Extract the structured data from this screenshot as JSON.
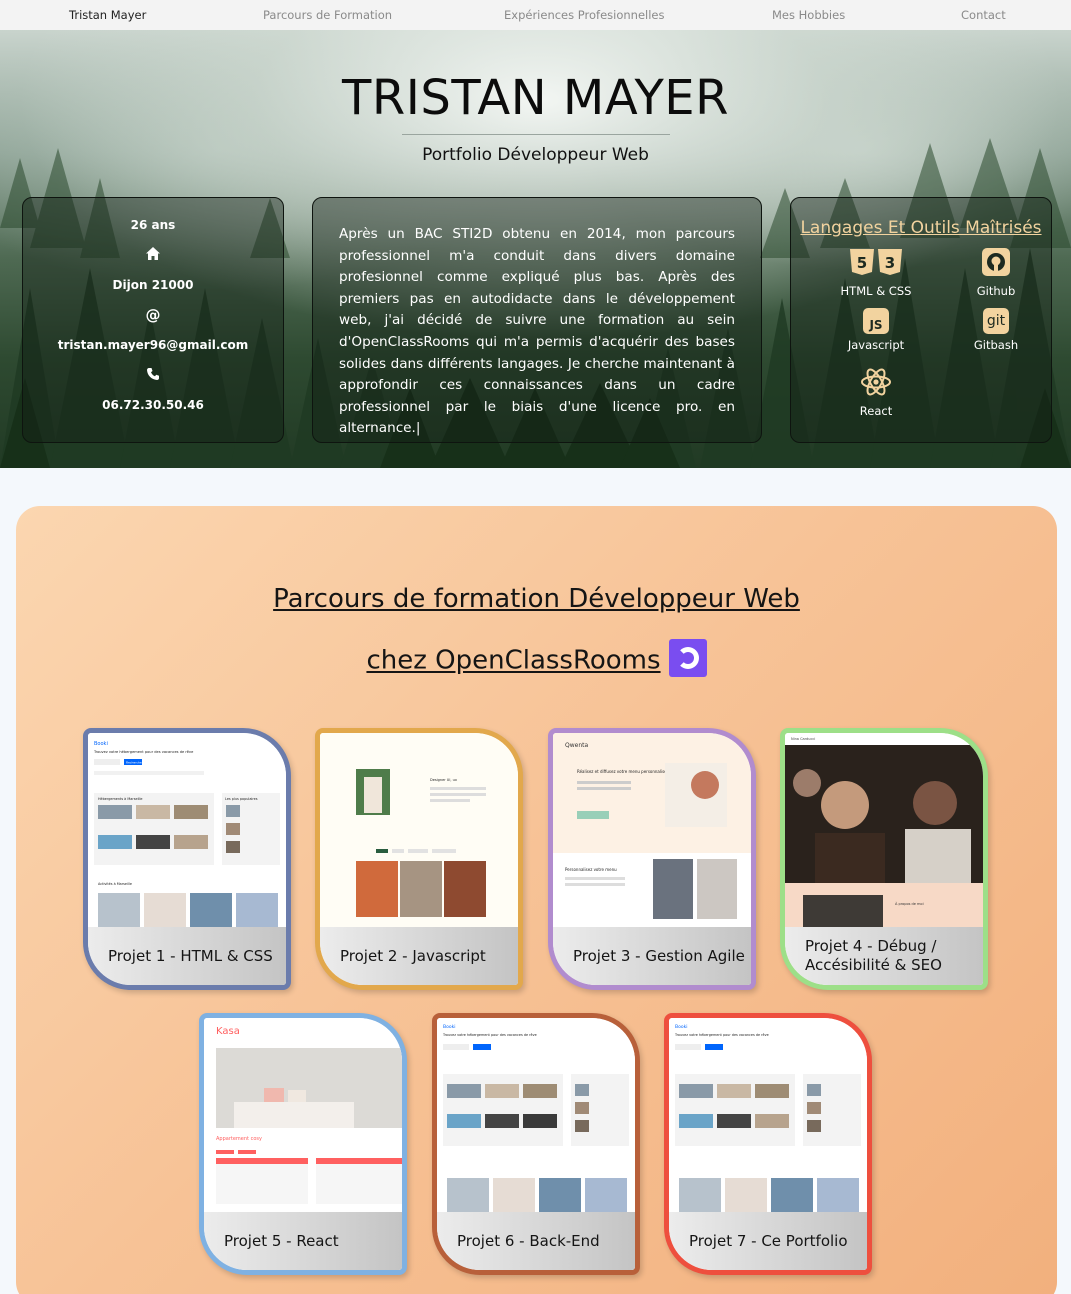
{
  "nav": {
    "brand": "Tristan Mayer",
    "links": [
      "Parcours de Formation",
      "Expériences Profesionnelles",
      "Mes Hobbies",
      "Contact"
    ]
  },
  "hero": {
    "title": "TRISTAN MAYER",
    "subtitle": "Portfolio Développeur Web"
  },
  "contact": {
    "age": "26 ans",
    "city": "Dijon 21000",
    "email": "tristan.mayer96@gmail.com",
    "phone": "06.72.30.50.46",
    "icons": [
      "home-icon",
      "at-icon",
      "phone-icon"
    ]
  },
  "bio": {
    "text": "Après un BAC STI2D obtenu en 2014, mon parcours professionnel m'a conduit dans divers domaine profesionnel comme expliqué plus bas. Après des premiers pas en autodidacte dans le développement web, j'ai décidé de suivre une formation au sein d'OpenClassRooms qui m'a permis d'acquérir des bases solides dans différents langages. Je cherche maintenant à approfondir ces connaissances dans un cadre professionnel par le biais d'une licence pro. en alternance.|"
  },
  "tools": {
    "title": "Langages Et Outils Maîtrisés",
    "items": [
      {
        "label": "HTML & CSS",
        "icon": "html-css-icon"
      },
      {
        "label": "Github",
        "icon": "github-icon"
      },
      {
        "label": "Javascript",
        "icon": "javascript-icon"
      },
      {
        "label": "Gitbash",
        "icon": "git-icon"
      },
      {
        "label": "React",
        "icon": "react-icon"
      }
    ],
    "badges": {
      "js": "JS",
      "git": "git"
    }
  },
  "formation": {
    "title_line1": "Parcours de formation Développeur Web",
    "title_line2": "chez OpenClassRooms",
    "projects": [
      {
        "label": "Projet 1 - HTML & CSS",
        "color": "#6b7cac"
      },
      {
        "label": "Projet 2 - Javascript",
        "color": "#e2a84c"
      },
      {
        "label": "Projet 3 - Gestion Agile",
        "color": "#b18cce"
      },
      {
        "label": "Projet 4 - Débug / Accésibilité & SEO",
        "color": "#9ddf88"
      },
      {
        "label": "Projet 5 - React",
        "color": "#7fb1e2"
      },
      {
        "label": "Projet 6 - Back-End",
        "color": "#b8603a"
      },
      {
        "label": "Projet 7 - Ce Portfolio",
        "color": "#ee4f3e"
      }
    ]
  },
  "thumbnails": {
    "booking_brand": "Booki",
    "booking_heading": "Trouvez votre hébergement pour des vacances de rêve",
    "booking_section": "Hébergements à Marseille",
    "booking_popular": "Les plus populaires",
    "booking_activities": "Activités à Marseille",
    "booking_search_button": "Rechercher",
    "designer_heading": "Designer UI, ux",
    "restaurant_brand": "Qwenta",
    "restaurant_tagline": "Réalisez et diffusez votre menu personnalisé",
    "restaurant_section": "Personnalisez votre menu",
    "seo_header": "Nina Carducci",
    "seo_about": "À propos de moi",
    "kasa_brand": "Kasa",
    "kasa_listing": "Appartement cosy"
  }
}
